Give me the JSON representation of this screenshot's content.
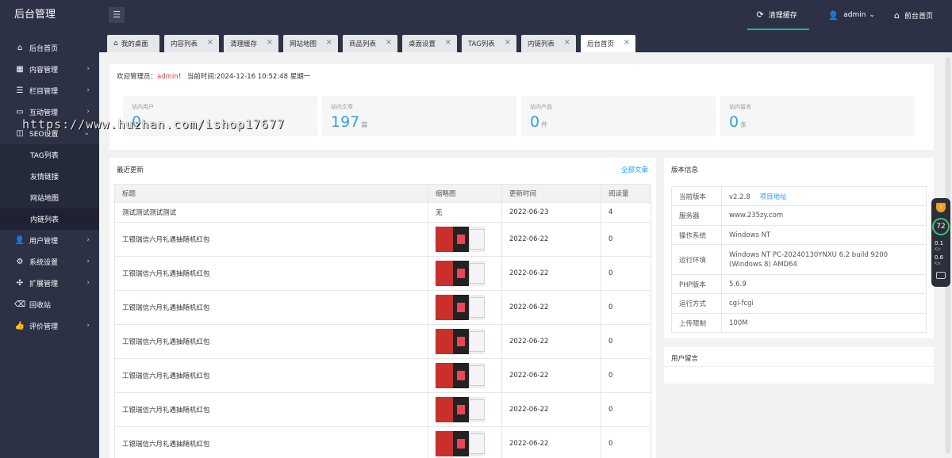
{
  "brand": "后台管理",
  "topbar": {
    "toggle_icon": "☰",
    "clear_cache": "清理缓存",
    "user": "admin",
    "front_home": "前台首页"
  },
  "sidebar": {
    "items": [
      {
        "icon": "home-icon",
        "label": "后台首页",
        "arrow": ""
      },
      {
        "icon": "grid-icon",
        "label": "内容管理",
        "arrow": "›"
      },
      {
        "icon": "list-icon",
        "label": "栏目管理",
        "arrow": "›"
      },
      {
        "icon": "message-icon",
        "label": "互动管理",
        "arrow": "›"
      },
      {
        "icon": "seo-icon",
        "label": "SEO设置",
        "arrow": "›"
      }
    ],
    "sub_items": [
      "TAG列表",
      "友情链接",
      "网站地图",
      "内链列表"
    ],
    "items_after": [
      {
        "icon": "user-icon",
        "label": "用户管理"
      },
      {
        "icon": "settings-icon",
        "label": "系统设置"
      },
      {
        "icon": "extend-icon",
        "label": "扩展管理"
      },
      {
        "icon": "trash-icon",
        "label": "回收站"
      },
      {
        "icon": "thumb-icon",
        "label": "评价管理"
      }
    ]
  },
  "tabs": [
    "我的桌面",
    "内容列表",
    "清理缓存",
    "网站地图",
    "商品列表",
    "桌面设置",
    "TAG列表",
    "内链列表",
    "后台首页"
  ],
  "welcome": {
    "prefix": "欢迎管理员：",
    "user": "admin",
    "suffix": "！ 当前时间:2024-12-16 10:52:48 星期一"
  },
  "stats": [
    {
      "label": "站内用户",
      "value": "0",
      "unit": ""
    },
    {
      "label": "站内文章",
      "value": "197",
      "unit": "篇"
    },
    {
      "label": "站内产品",
      "value": "0",
      "unit": "件"
    },
    {
      "label": "站内留言",
      "value": "0",
      "unit": "条"
    }
  ],
  "latest": {
    "title": "最近更新",
    "all_link": "全部文章",
    "headers": [
      "标题",
      "缩略图",
      "更新时间",
      "阅读量"
    ],
    "rows": [
      {
        "title": "测试测试测试测试",
        "thumb": "无",
        "date": "2022-06-23",
        "reads": "4"
      },
      {
        "title": "工银瑞信六月礼遇抽随机红包",
        "thumb": "",
        "date": "2022-06-22",
        "reads": "0"
      },
      {
        "title": "工银瑞信六月礼遇抽随机红包",
        "thumb": "",
        "date": "2022-06-22",
        "reads": "0"
      },
      {
        "title": "工银瑞信六月礼遇抽随机红包",
        "thumb": "",
        "date": "2022-06-22",
        "reads": "0"
      },
      {
        "title": "工银瑞信六月礼遇抽随机红包",
        "thumb": "",
        "date": "2022-06-22",
        "reads": "0"
      },
      {
        "title": "工银瑞信六月礼遇抽随机红包",
        "thumb": "",
        "date": "2022-06-22",
        "reads": "0"
      },
      {
        "title": "工银瑞信六月礼遇抽随机红包",
        "thumb": "",
        "date": "2022-06-22",
        "reads": "0"
      },
      {
        "title": "工银瑞信六月礼遇抽随机红包",
        "thumb": "",
        "date": "2022-06-22",
        "reads": "0"
      }
    ]
  },
  "version": {
    "title": "版本信息",
    "rows": [
      {
        "key": "当前版本",
        "value": "v2.2.8",
        "link": "项目地址"
      },
      {
        "key": "服务器",
        "value": "www.235zy.com",
        "link": ""
      },
      {
        "key": "操作系统",
        "value": "Windows NT",
        "link": ""
      },
      {
        "key": "运行环境",
        "value": "Windows NT PC-20240130YNXU 6.2 build 9200 (Windows 8) AMD64",
        "link": ""
      },
      {
        "key": "PHP版本",
        "value": "5.6.9",
        "link": ""
      },
      {
        "key": "运行方式",
        "value": "cgi-fcgi",
        "link": ""
      },
      {
        "key": "上传限制",
        "value": "100M",
        "link": ""
      }
    ]
  },
  "guestbook": {
    "title": "用户留言"
  },
  "widget": {
    "score": "72",
    "up": "0.1",
    "up_unit": "K/s",
    "down": "0.6",
    "down_unit": "K/s"
  },
  "watermark": "https://www.huzhan.com/ishop17677"
}
